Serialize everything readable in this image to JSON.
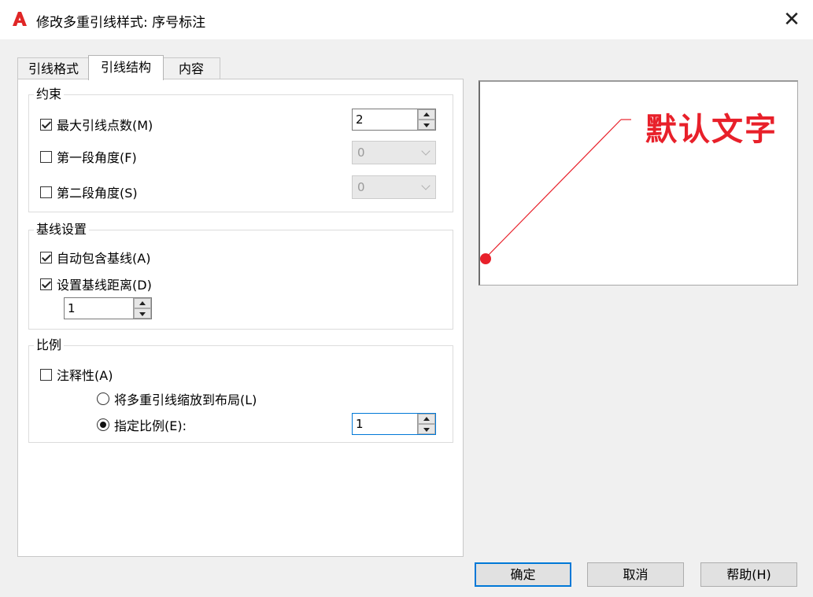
{
  "window": {
    "title": "修改多重引线样式: 序号标注",
    "icons": {
      "app": "autocad-a-icon",
      "close": "close-icon"
    },
    "close_glyph": "✕"
  },
  "tabs": [
    {
      "label": "引线格式",
      "active": false
    },
    {
      "label": "引线结构",
      "active": true
    },
    {
      "label": "内容",
      "active": false
    }
  ],
  "constraints": {
    "title": "约束",
    "max_points": {
      "label": "最大引线点数(M)",
      "checked": true,
      "value": "2"
    },
    "first_angle": {
      "label": "第一段角度(F)",
      "checked": false,
      "value": "0",
      "enabled": false
    },
    "second_angle": {
      "label": "第二段角度(S)",
      "checked": false,
      "value": "0",
      "enabled": false
    }
  },
  "landing": {
    "title": "基线设置",
    "auto_include": {
      "label": "自动包含基线(A)",
      "checked": true
    },
    "set_distance": {
      "label": "设置基线距离(D)",
      "checked": true,
      "value": "1"
    }
  },
  "scale": {
    "title": "比例",
    "annotative": {
      "label": "注释性(A)",
      "checked": false
    },
    "scale_to_layout": {
      "label": "将多重引线缩放到布局(L)",
      "selected": false
    },
    "specify_scale": {
      "label": "指定比例(E):",
      "selected": true,
      "value": "1"
    }
  },
  "preview": {
    "text": "默认文字",
    "colors": {
      "leader": "#e8202a",
      "text": "#e8202a"
    }
  },
  "buttons": {
    "ok": "确定",
    "cancel": "取消",
    "help": "帮助(H)"
  },
  "colors": {
    "accent": "#0078d7",
    "title_bg": "#ffffff",
    "dialog_bg": "#f0f0f0"
  }
}
